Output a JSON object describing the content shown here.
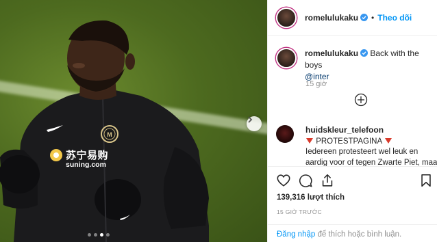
{
  "post": {
    "username": "romelulukaku",
    "follow_label": "Theo dõi",
    "dot_separator": "•",
    "caption_text": "Back with the boys",
    "caption_mention": "@inter",
    "caption_time": "15 giờ",
    "carousel": {
      "total": 4,
      "active_index": 2
    }
  },
  "photo": {
    "jersey_sponsor_cn": "苏宁易购",
    "jersey_sponsor_url": "suning.com"
  },
  "comment": {
    "username": "huidskleur_telefoon",
    "line1": "PROTESTPAGINA",
    "line2": "Iedereen protesteert wel leuk en",
    "line3": "aardig voor of tegen Zwarte Piet, maa"
  },
  "stats": {
    "likes_count": "139,316",
    "likes_label": "lượt thích",
    "posted_ago": "15 GIỜ TRƯỚC"
  },
  "login": {
    "link": "Đăng nhập",
    "text": " để thích hoặc bình luận."
  },
  "icons": {
    "like": "heart-icon",
    "comment": "comment-icon",
    "share": "share-icon",
    "save": "bookmark-icon",
    "verified": "verified-badge-icon",
    "next": "chevron-right-icon",
    "add": "plus-circle-icon"
  },
  "colors": {
    "accent_link": "#0095f6",
    "verified": "#3897f0",
    "protest_triangle": "#d93a2b",
    "muted_text": "#8e8e8e"
  }
}
